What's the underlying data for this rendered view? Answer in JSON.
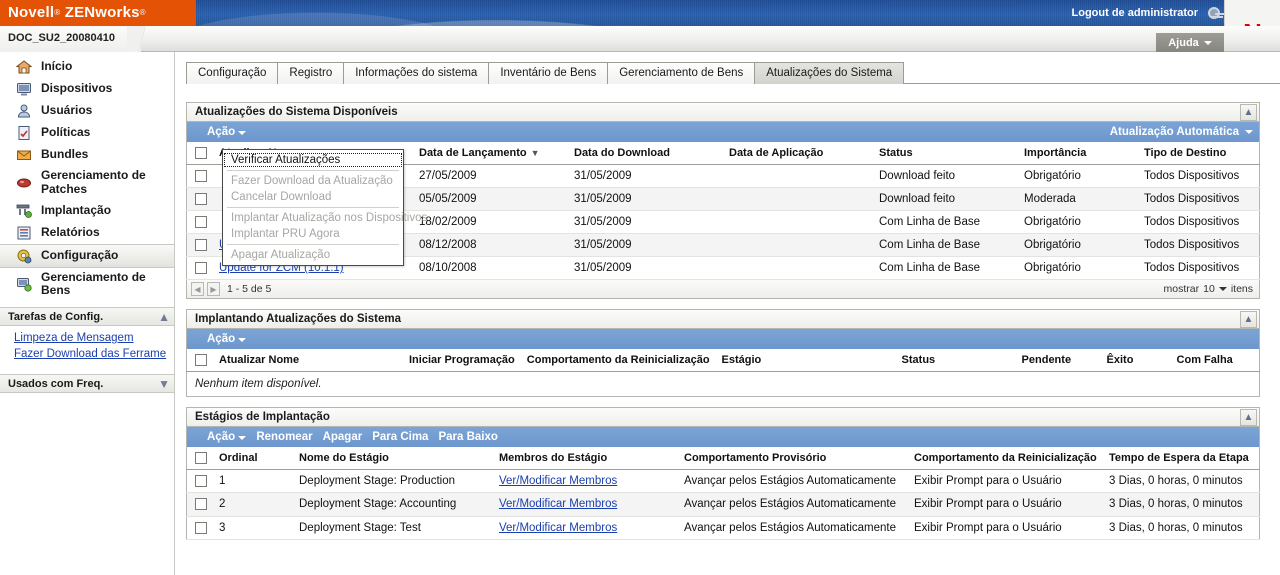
{
  "banner": {
    "product_name": "Novell",
    "product_suffix": "ZENworks",
    "logout_label": "Logout de administrator",
    "key_icon": "key-icon",
    "n_logo": "N"
  },
  "strip": {
    "zone_name": "DOC_SU2_20080410",
    "help_label": "Ajuda"
  },
  "sidebar": {
    "items": [
      {
        "label": "Início",
        "icon": "home-icon",
        "selected": false
      },
      {
        "label": "Dispositivos",
        "icon": "monitor-icon",
        "selected": false
      },
      {
        "label": "Usuários",
        "icon": "user-icon",
        "selected": false
      },
      {
        "label": "Políticas",
        "icon": "policy-icon",
        "selected": false
      },
      {
        "label": "Bundles",
        "icon": "bundle-icon",
        "selected": false
      },
      {
        "label": "Gerenciamento de Patches",
        "icon": "patch-icon",
        "selected": false
      },
      {
        "label": "Implantação",
        "icon": "deployment-icon",
        "selected": false
      },
      {
        "label": "Relatórios",
        "icon": "report-icon",
        "selected": false
      },
      {
        "label": "Configuração",
        "icon": "config-icon",
        "selected": true
      },
      {
        "label": "Gerenciamento de Bens",
        "icon": "asset-icon",
        "selected": false
      }
    ],
    "sections": [
      {
        "title": "Tarefas de Config.",
        "chevron": "chevron-up-icon",
        "links": [
          "Limpeza de Mensagem",
          "Fazer Download das Ferrame"
        ]
      },
      {
        "title": "Usados com Freq.",
        "chevron": "chevron-down-icon",
        "links": []
      }
    ]
  },
  "tabs": [
    {
      "label": "Configuração",
      "active": false
    },
    {
      "label": "Registro",
      "active": false
    },
    {
      "label": "Informações do sistema",
      "active": false
    },
    {
      "label": "Inventário de Bens",
      "active": false
    },
    {
      "label": "Gerenciamento de Bens",
      "active": false
    },
    {
      "label": "Atualizações do Sistema",
      "active": true
    }
  ],
  "available_updates": {
    "title": "Atualizações do Sistema Disponíveis",
    "action_label": "Ação",
    "auto_update_label": "Atualização Automática",
    "columns": [
      "Atualizar Nome",
      "Data de Lançamento",
      "Data do Download",
      "Data de Aplicação",
      "Status",
      "Importância",
      "Tipo de Destino"
    ],
    "sorted_column": "Data de Lançamento",
    "rows": [
      {
        "name": "",
        "release": "27/05/2009",
        "download": "31/05/2009",
        "applied": "",
        "status": "Download feito",
        "importance": "Obrigatório",
        "target": "Todos Dispositivos"
      },
      {
        "name": "",
        "release": "05/05/2009",
        "download": "31/05/2009",
        "applied": "",
        "status": "Download feito",
        "importance": "Moderada",
        "target": "Todos Dispositivos"
      },
      {
        "name": "",
        "release": "18/02/2009",
        "download": "31/05/2009",
        "applied": "",
        "status": "Com Linha de Base",
        "importance": "Obrigatório",
        "target": "Todos Dispositivos"
      },
      {
        "name": "Update for ZCM (10.1.2a)",
        "release": "08/12/2008",
        "download": "31/05/2009",
        "applied": "",
        "status": "Com Linha de Base",
        "importance": "Obrigatório",
        "target": "Todos Dispositivos"
      },
      {
        "name": "Update for ZCM (10.1.1)",
        "release": "08/10/2008",
        "download": "31/05/2009",
        "applied": "",
        "status": "Com Linha de Base",
        "importance": "Obrigatório",
        "target": "Todos Dispositivos"
      }
    ],
    "pager": {
      "range": "1 - 5 de 5",
      "show_label": "mostrar",
      "page_size": "10",
      "items_label": "itens"
    }
  },
  "action_menu": {
    "items": [
      {
        "label": "Verificar Atualizações",
        "enabled": true,
        "focused": true
      },
      {
        "label": "Fazer Download da Atualização",
        "enabled": false,
        "sep_before": true
      },
      {
        "label": "Cancelar Download",
        "enabled": false
      },
      {
        "label": "Implantar Atualização nos Dispositivos",
        "enabled": false,
        "sep_before": true
      },
      {
        "label": "Implantar PRU Agora",
        "enabled": false
      },
      {
        "label": "Apagar Atualização",
        "enabled": false,
        "sep_before": true
      }
    ]
  },
  "deploying_updates": {
    "title": "Implantando Atualizações do Sistema",
    "action_label": "Ação",
    "columns": [
      "Atualizar Nome",
      "Iniciar Programação",
      "Comportamento da Reinicialização",
      "Estágio",
      "Status",
      "Pendente",
      "Êxito",
      "Com Falha"
    ],
    "empty_message": "Nenhum item disponível."
  },
  "deployment_stages": {
    "title": "Estágios de Implantação",
    "action_label": "Ação",
    "toolbar_links": [
      "Renomear",
      "Apagar",
      "Para Cima",
      "Para Baixo"
    ],
    "columns": [
      "Ordinal",
      "Nome do Estágio",
      "Membros do Estágio",
      "Comportamento Provisório",
      "Comportamento da Reinicialização",
      "Tempo de Espera da Etapa"
    ],
    "rows": [
      {
        "ordinal": "1",
        "stage_name": "Deployment Stage: Production",
        "members_link": "Ver/Modificar Membros",
        "provisional": "Avançar pelos Estágios Automaticamente",
        "reboot": "Exibir Prompt para o Usuário",
        "wait": "3 Dias, 0 horas, 0 minutos"
      },
      {
        "ordinal": "2",
        "stage_name": "Deployment Stage: Accounting",
        "members_link": "Ver/Modificar Membros",
        "provisional": "Avançar pelos Estágios Automaticamente",
        "reboot": "Exibir Prompt para o Usuário",
        "wait": "3 Dias, 0 horas, 0 minutos"
      },
      {
        "ordinal": "3",
        "stage_name": "Deployment Stage: Test",
        "members_link": "Ver/Modificar Membros",
        "provisional": "Avançar pelos Estágios Automaticamente",
        "reboot": "Exibir Prompt para o Usuário",
        "wait": "3 Dias, 0 horas, 0 minutos"
      }
    ]
  },
  "colors": {
    "brand_orange": "#e35205",
    "banner_blue": "#2a5caa",
    "action_bar_blue": "#6f9bd1",
    "link_blue": "#1b3fae",
    "novell_red": "#e00000"
  }
}
